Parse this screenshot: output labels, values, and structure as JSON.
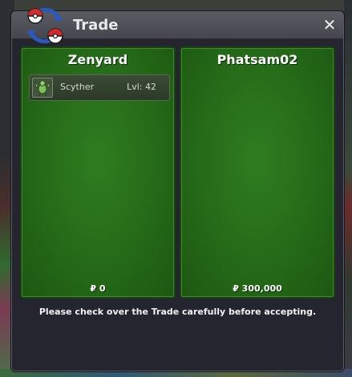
{
  "window": {
    "title": "Trade",
    "close_label": "✕",
    "notice": "Please check over the Trade carefully before accepting."
  },
  "left_panel": {
    "player_name": "Zenyard",
    "money": "₽ 0",
    "items": [
      {
        "name": "Scyther",
        "level": "Lvl: 42",
        "icon": "scyther-icon"
      }
    ]
  },
  "right_panel": {
    "player_name": "Phatsam02",
    "money": "₽ 300,000",
    "items": []
  },
  "colors": {
    "panel_green": "#2f7d20",
    "window_bg": "#25252f",
    "titlebar": "#4e4e56"
  }
}
